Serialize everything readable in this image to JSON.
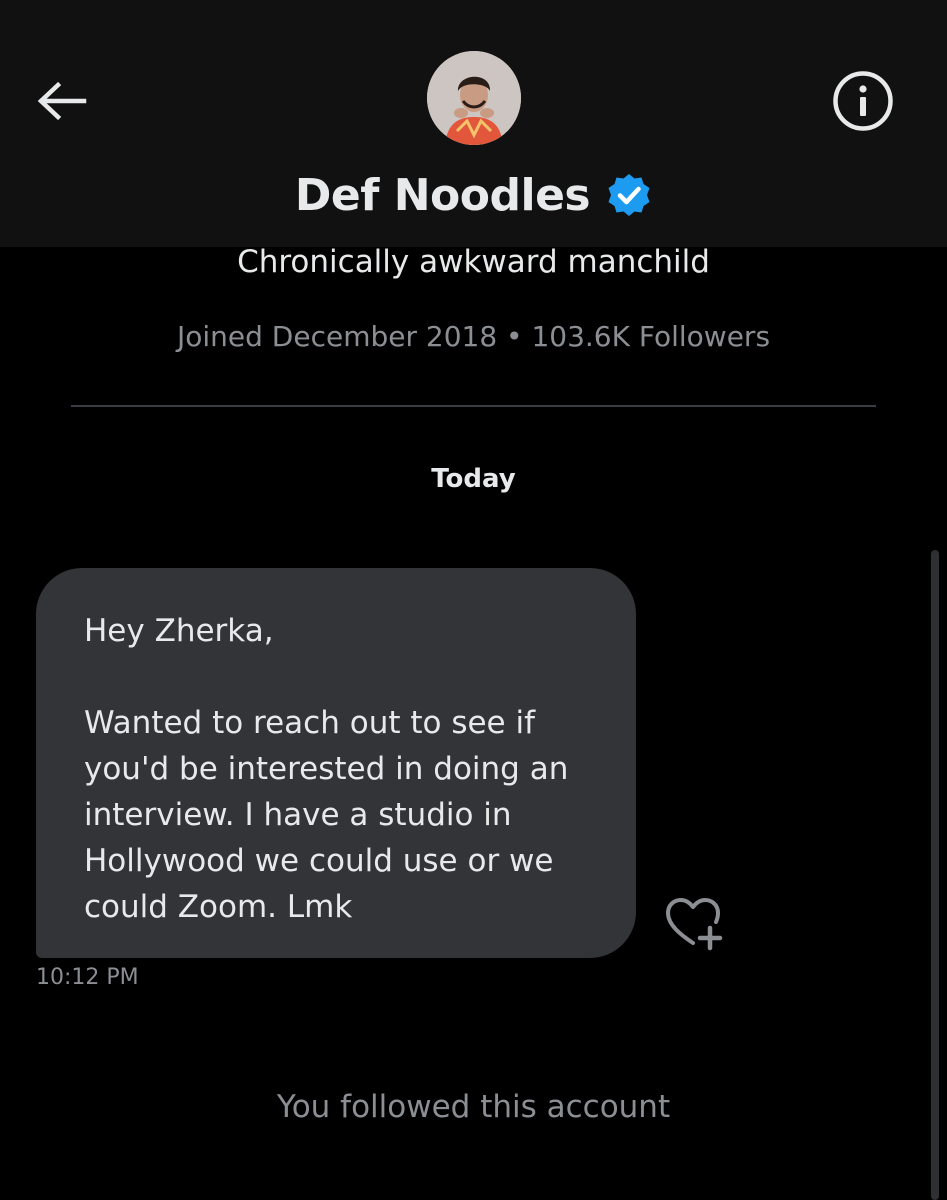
{
  "header": {
    "back_icon": "arrow-left-icon",
    "info_icon": "info-circle-icon",
    "avatar_icon": "profile-avatar",
    "name": "Def Noodles",
    "verified_icon": "verified-badge-icon",
    "verified_color": "#1d9bf0"
  },
  "profile": {
    "bio": "Chronically awkward manchild",
    "meta": "Joined December 2018 • 103.6K Followers"
  },
  "conversation": {
    "date_separator": "Today",
    "messages": [
      {
        "greeting": "Hey Zherka,",
        "body": "Wanted to reach out to see if you'd be interested in doing an interview. I have a studio in Hollywood we could use or we could Zoom. Lmk",
        "time": "10:12 PM",
        "react_icon": "heart-plus-icon"
      }
    ],
    "system_message": "You followed this account"
  },
  "colors": {
    "background": "#000000",
    "header_bg": "#111111",
    "bubble_bg": "#333438",
    "secondary_text": "#8b8f94"
  }
}
